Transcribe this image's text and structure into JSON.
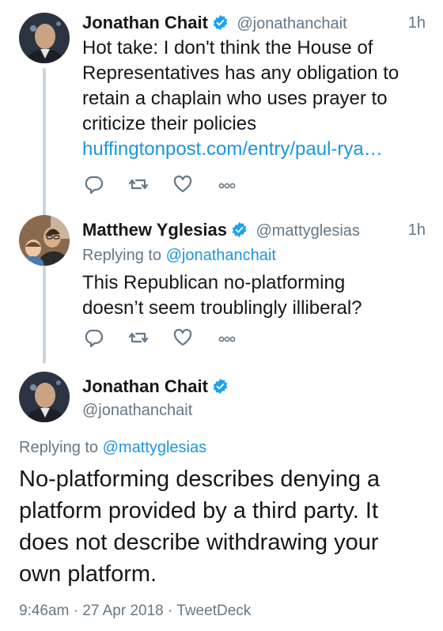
{
  "tweets": [
    {
      "name": "Jonathan Chait",
      "handle": "@jonathanchait",
      "time": "1h",
      "text_lines": [
        "Hot take: I don't think the House of",
        "Representatives has any obligation to",
        "retain a chaplain who uses prayer to",
        "criticize their policies"
      ],
      "link": "huffingtonpost.com/entry/paul-rya…"
    },
    {
      "name": "Matthew Yglesias",
      "handle": "@mattyglesias",
      "time": "1h",
      "replying_label": "Replying to",
      "replying_to": "@jonathanchait",
      "text_lines": [
        "This Republican no-platforming",
        "doesn’t seem troublingly illiberal?"
      ]
    }
  ],
  "main_tweet": {
    "name": "Jonathan Chait",
    "handle": "@jonathanchait",
    "replying_label": "Replying to",
    "replying_to": "@mattyglesias",
    "text_lines": [
      "No-platforming describes denying a",
      "platform provided by a third party. It",
      "does not describe withdrawing your",
      "own platform."
    ],
    "meta": "9:46am · 27 Apr 2018 · TweetDeck"
  },
  "colors": {
    "verified": "#1da1f2",
    "link": "#1b95e0",
    "secondary_text": "#657786",
    "action_icon": "#657786"
  },
  "icons": [
    "reply-icon",
    "retweet-icon",
    "like-icon",
    "more-icon",
    "verified-badge-icon"
  ]
}
